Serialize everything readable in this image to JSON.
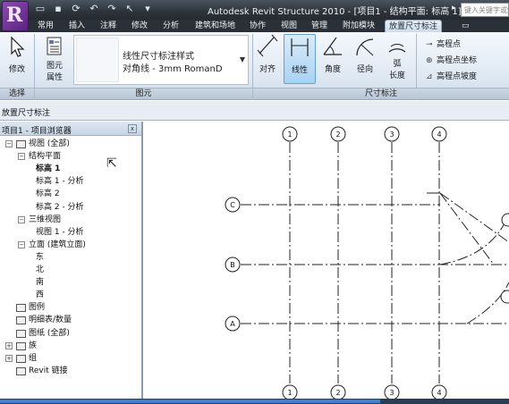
{
  "window": {
    "app_logo_letter": "R",
    "title": "Autodesk Revit Structure 2010 - [项目1 - 结构平面: 标高 1]",
    "search_placeholder": "键入关键字或短语"
  },
  "quick_access": [
    "open-icon",
    "save-icon",
    "sync-icon",
    "undo-icon",
    "redo-icon",
    "pointer-icon",
    "print-icon"
  ],
  "tabs": [
    {
      "label": "常用",
      "active": false
    },
    {
      "label": "插入",
      "active": false
    },
    {
      "label": "注释",
      "active": false
    },
    {
      "label": "修改",
      "active": false
    },
    {
      "label": "分析",
      "active": false
    },
    {
      "label": "建筑和场地",
      "active": false
    },
    {
      "label": "协作",
      "active": false
    },
    {
      "label": "视图",
      "active": false
    },
    {
      "label": "管理",
      "active": false
    },
    {
      "label": "附加模块",
      "active": false
    },
    {
      "label": "放置尺寸标注",
      "active": true
    }
  ],
  "ribbon": {
    "modify_label": "修改",
    "element_props_label_1": "图元",
    "element_props_label_2": "属性",
    "type_line1": "线性尺寸标注样式",
    "type_line2": "对角线 - 3mm RomanD",
    "dim_buttons": [
      {
        "label": "对齐",
        "active": false
      },
      {
        "label": "线性",
        "active": true
      },
      {
        "label": "角度",
        "active": false
      },
      {
        "label": "径向",
        "active": false
      },
      {
        "label": "弧",
        "label2": "长度",
        "active": false
      }
    ],
    "spot_items": [
      "高程点",
      "高程点坐标",
      "高程点坡度"
    ],
    "panels": {
      "select": "选择",
      "element": "图元",
      "dimension": "尺寸标注"
    }
  },
  "options_bar": {
    "label": "放置尺寸标注"
  },
  "browser": {
    "title": "项目1 - 项目浏览器",
    "tree": [
      {
        "label": "视图 (全部)",
        "level": 0,
        "toggle": "−",
        "icon": "views-icon"
      },
      {
        "label": "结构平面",
        "level": 1,
        "toggle": "−"
      },
      {
        "label": "标高 1",
        "level": 2,
        "bold": true
      },
      {
        "label": "标高 1 - 分析",
        "level": 2
      },
      {
        "label": "标高 2",
        "level": 2
      },
      {
        "label": "标高 2 - 分析",
        "level": 2
      },
      {
        "label": "三维视图",
        "level": 1,
        "toggle": "−"
      },
      {
        "label": "视图 1 - 分析",
        "level": 2
      },
      {
        "label": "立面 (建筑立面)",
        "level": 1,
        "toggle": "−"
      },
      {
        "label": "东",
        "level": 2
      },
      {
        "label": "北",
        "level": 2
      },
      {
        "label": "南",
        "level": 2
      },
      {
        "label": "西",
        "level": 2
      },
      {
        "label": "图例",
        "level": 0,
        "icon": "legend-icon"
      },
      {
        "label": "明细表/数量",
        "level": 0,
        "icon": "schedule-icon"
      },
      {
        "label": "图纸 (全部)",
        "level": 0,
        "icon": "sheets-icon"
      },
      {
        "label": "族",
        "level": 0,
        "toggle": "+",
        "icon": "family-icon"
      },
      {
        "label": "组",
        "level": 0,
        "toggle": "+",
        "icon": "group-icon"
      },
      {
        "label": "Revit 链接",
        "level": 0,
        "icon": "link-icon"
      }
    ]
  },
  "grid": {
    "column_bubbles": [
      "1",
      "2",
      "3",
      "4"
    ],
    "row_bubbles": [
      "C",
      "B",
      "A"
    ]
  }
}
